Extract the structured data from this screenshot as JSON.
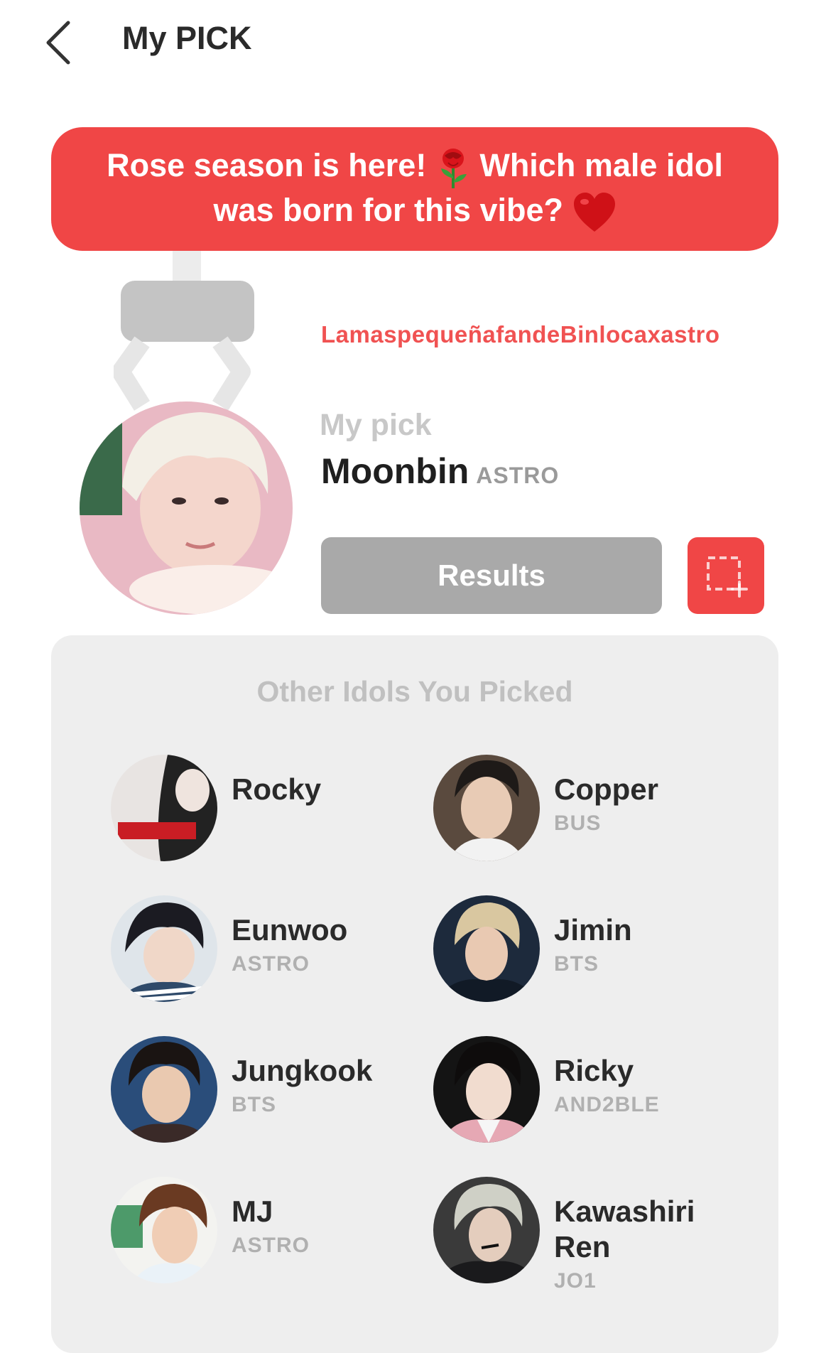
{
  "header": {
    "title": "My PICK"
  },
  "banner": {
    "text_line1": "Rose season is here!",
    "text_line1b": "Which male idol",
    "text_line2": "was born for this vibe?"
  },
  "user": {
    "username": "LamaspequeñafandeBinlocaxastro"
  },
  "my_pick": {
    "label": "My pick",
    "name": "Moonbin",
    "group": "ASTRO"
  },
  "actions": {
    "results_label": "Results"
  },
  "others": {
    "title": "Other Idols You Picked",
    "idols": [
      {
        "name": "Rocky",
        "group": ""
      },
      {
        "name": "Copper",
        "group": "BUS"
      },
      {
        "name": "Eunwoo",
        "group": "ASTRO"
      },
      {
        "name": "Jimin",
        "group": "BTS"
      },
      {
        "name": "Jungkook",
        "group": "BTS"
      },
      {
        "name": "Ricky",
        "group": "AND2BLE"
      },
      {
        "name": "MJ",
        "group": "ASTRO"
      },
      {
        "name": "Kawashiri Ren",
        "group": "JO1"
      }
    ]
  },
  "colors": {
    "accent": "#f04646",
    "username": "#f05252",
    "button_gray": "#a9a9a9",
    "panel_bg": "#eeeeee"
  },
  "icons": {
    "back": "chevron-left-icon",
    "capture": "capture-add-icon",
    "rose": "rose-emoji",
    "heart": "heart-emoji"
  }
}
